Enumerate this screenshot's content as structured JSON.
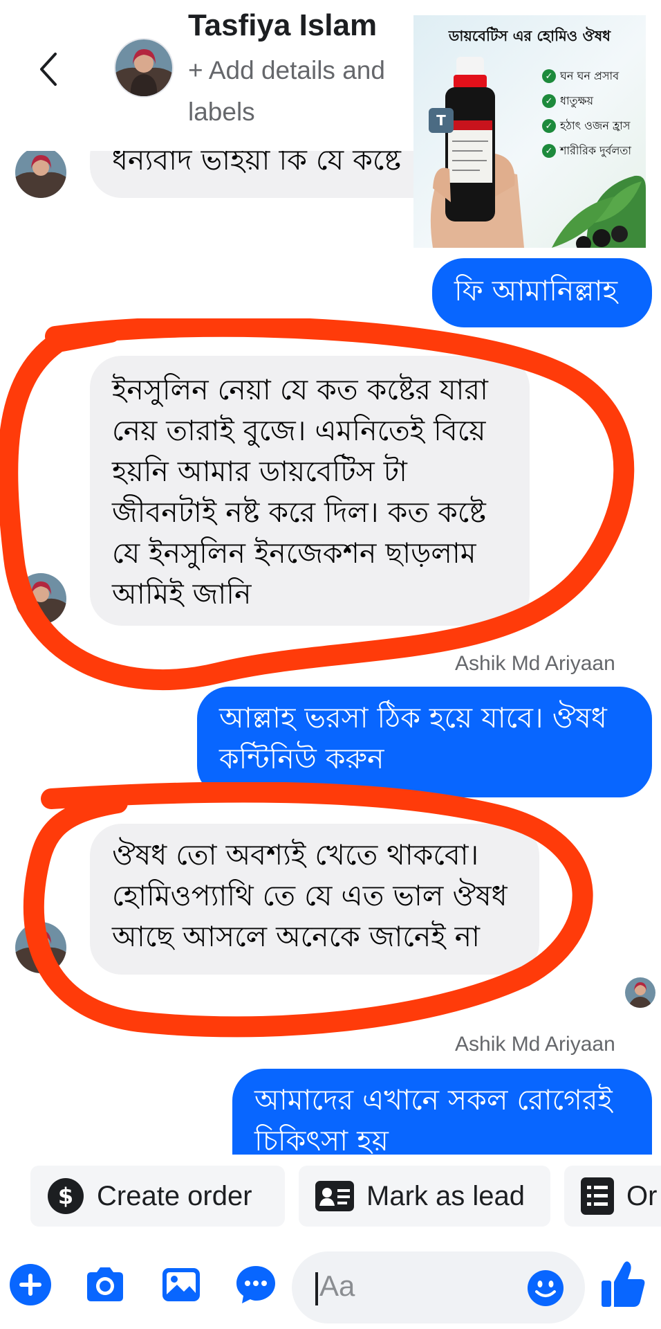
{
  "header": {
    "contact_name": "Tasfiya Islam",
    "subtitle": "+ Add details and labels"
  },
  "ad": {
    "title": "ডায়বেটিস এর হোমিও ঔষধ",
    "badge": "T",
    "points": [
      "ঘন ঘন প্রসাব",
      "ধাতুক্ষয়",
      "হঠাৎ ওজন হ্রাস",
      "শারীরিক দুর্বলতা"
    ]
  },
  "messages": [
    {
      "direction": "incoming",
      "text": "ধন্যবাদ ভাইয়া কি যে কষ্টে"
    },
    {
      "direction": "outgoing",
      "text": "ফি আমানিল্লাহ"
    },
    {
      "direction": "incoming",
      "text": "ইনসুলিন নেয়া যে কত কষ্টের যারা নেয় তারাই বুজে। এমনিতেই বিয়ে হয়নি আমার ডায়বেটিস টা জীবনটাই নষ্ট করে দিল। কত কষ্টে যে ইনসুলিন ইনজেকশন ছাড়লাম আমিই জানি"
    },
    {
      "direction": "outgoing",
      "sender": "Ashik Md Ariyaan",
      "text": "আল্লাহ ভরসা ঠিক হয়ে যাবে। ঔষধ কন্টিনিউ করুন"
    },
    {
      "direction": "incoming",
      "text": "ঔষধ তো অবশ্যই খেতে থাকবো। হোমিওপ্যাথি তে যে এত ভাল ঔষধ আছে আসলে অনেকে জানেই না"
    },
    {
      "direction": "outgoing",
      "sender": "Ashik Md Ariyaan",
      "text": "আমাদের এখানে সকল রোগেরই চিকিৎসা হয়"
    }
  ],
  "quick_actions": [
    {
      "label": "Create order",
      "icon": "dollar-icon"
    },
    {
      "label": "Mark as lead",
      "icon": "contact-card-icon"
    },
    {
      "label": "Or",
      "icon": "order-list-icon"
    }
  ],
  "composer": {
    "placeholder": "Aa"
  },
  "colors": {
    "outgoing_bubble": "#0866ff",
    "incoming_bubble": "#f0f0f2",
    "annotation": "#ff3b0a"
  }
}
